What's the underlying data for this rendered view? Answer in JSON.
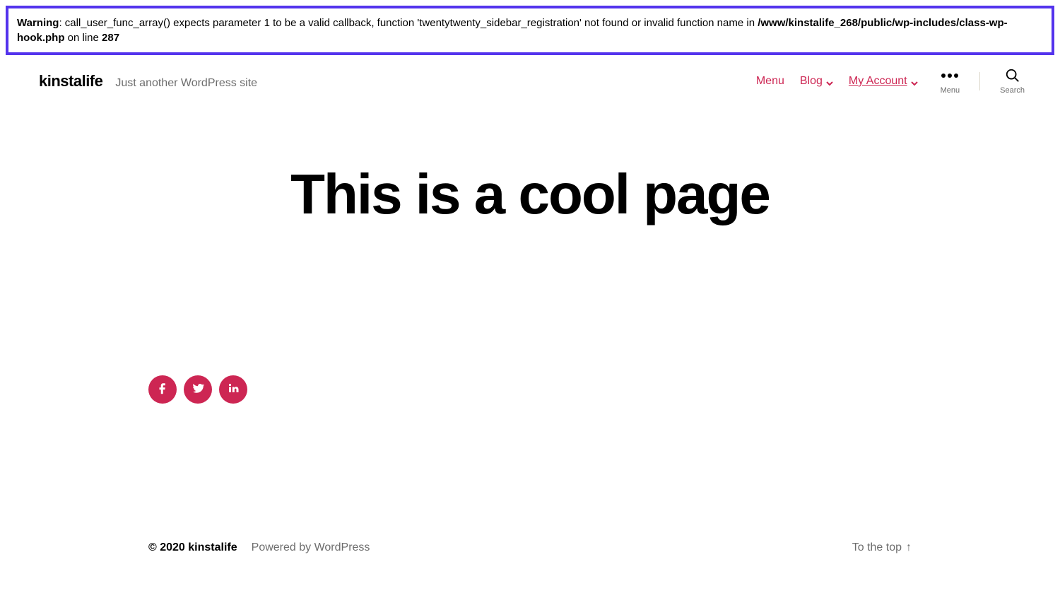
{
  "warning": {
    "label": "Warning",
    "text1": ": call_user_func_array() expects parameter 1 to be a valid callback, function 'twentytwenty_sidebar_registration' not found or invalid function name in ",
    "path": "/www/kinstalife_268/public/wp-includes/class-wp-hook.php",
    "text2": " on line ",
    "line": "287"
  },
  "header": {
    "site_title": "kinstalife",
    "tagline": "Just another WordPress site"
  },
  "nav": {
    "menu": "Menu",
    "blog": "Blog",
    "account": "My Account"
  },
  "toolbar": {
    "menu_label": "Menu",
    "search_label": "Search"
  },
  "page": {
    "title": "This is a cool page"
  },
  "footer": {
    "copyright": "© 2020 kinstalife",
    "powered": "Powered by WordPress",
    "to_top": "To the top"
  }
}
